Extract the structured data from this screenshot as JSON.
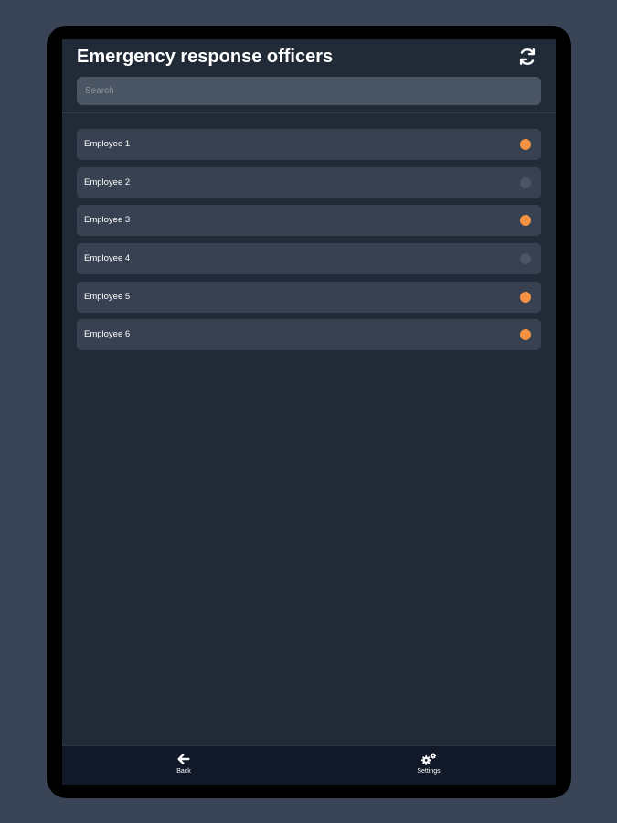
{
  "header": {
    "title": "Emergency response officers",
    "refresh_icon": "refresh-icon"
  },
  "search": {
    "placeholder": "Search",
    "value": ""
  },
  "status_colors": {
    "active": "#f59142",
    "inactive": "#4b5563"
  },
  "employees": [
    {
      "name": "Employee 1",
      "status": "active"
    },
    {
      "name": "Employee 2",
      "status": "inactive"
    },
    {
      "name": "Employee 3",
      "status": "active"
    },
    {
      "name": "Employee 4",
      "status": "inactive"
    },
    {
      "name": "Employee 5",
      "status": "active"
    },
    {
      "name": "Employee 6",
      "status": "active"
    }
  ],
  "nav": {
    "back": {
      "label": "Back",
      "icon": "arrow-left-icon"
    },
    "settings": {
      "label": "Settings",
      "icon": "gears-icon"
    }
  },
  "colors": {
    "background": "#394556",
    "screen": "#212a37",
    "row": "#374151",
    "search": "#4a5564",
    "bottom_nav": "#111827"
  }
}
